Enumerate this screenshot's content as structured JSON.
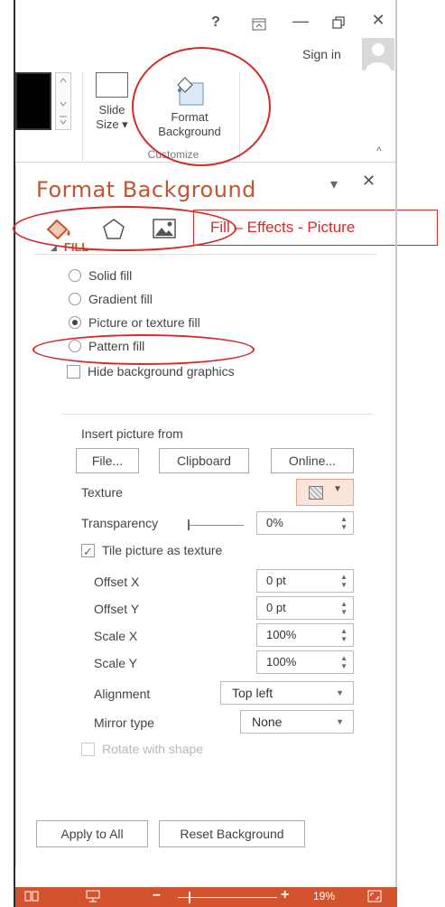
{
  "window": {
    "help_glyph": "?",
    "ribbon_display_glyph": "⊼",
    "minimize_glyph": "—",
    "restore_glyph": "❐",
    "close_glyph": "✕",
    "sign_in": "Sign in"
  },
  "ribbon": {
    "slide_size_label_1": "Slide",
    "slide_size_label_2": "Size ▾",
    "format_background_label_1": "Format",
    "format_background_label_2": "Background",
    "group_label": "Customize",
    "collapse_glyph": "^"
  },
  "pane": {
    "title": "Format Background",
    "options_glyph": "▾",
    "close_glyph": "✕",
    "tabs": [
      {
        "name": "Fill",
        "icon": "paint-bucket-icon",
        "active": true
      },
      {
        "name": "Effects",
        "icon": "pentagon-icon",
        "active": false
      },
      {
        "name": "Picture",
        "icon": "picture-icon",
        "active": false
      }
    ],
    "callout_text": "Fill – Effects - Picture",
    "section_title": "FILL",
    "fill_options": [
      {
        "label": "Solid fill",
        "checked": false
      },
      {
        "label": "Gradient fill",
        "checked": false
      },
      {
        "label": "Picture or texture fill",
        "checked": true
      },
      {
        "label": "Pattern fill",
        "checked": false
      }
    ],
    "hide_background_graphics": "Hide background graphics",
    "insert_picture_from": "Insert picture from",
    "file_button": "File...",
    "clipboard_button": "Clipboard",
    "online_button": "Online...",
    "texture_label": "Texture",
    "texture_dropdown_glyph": "▼",
    "transparency_label": "Transparency",
    "transparency_value": "0%",
    "transparency_fraction": 0,
    "tile_picture": "Tile picture as texture",
    "tile_checked": true,
    "offset_x_label": "Offset X",
    "offset_x_value": "0 pt",
    "offset_y_label": "Offset Y",
    "offset_y_value": "0 pt",
    "scale_x_label": "Scale X",
    "scale_x_value": "100%",
    "scale_y_label": "Scale Y",
    "scale_y_value": "100%",
    "alignment_label": "Alignment",
    "alignment_value": "Top left",
    "mirror_label": "Mirror type",
    "mirror_value": "None",
    "rotate_with_shape": "Rotate with shape",
    "apply_to_all": "Apply to All",
    "reset_background": "Reset Background"
  },
  "status": {
    "zoom_minus": "–",
    "zoom_plus": "+",
    "zoom_value": "19%"
  },
  "colors": {
    "accent": "#c4532f",
    "statusbar": "#d2532d",
    "annotation": "#d42a2a"
  }
}
